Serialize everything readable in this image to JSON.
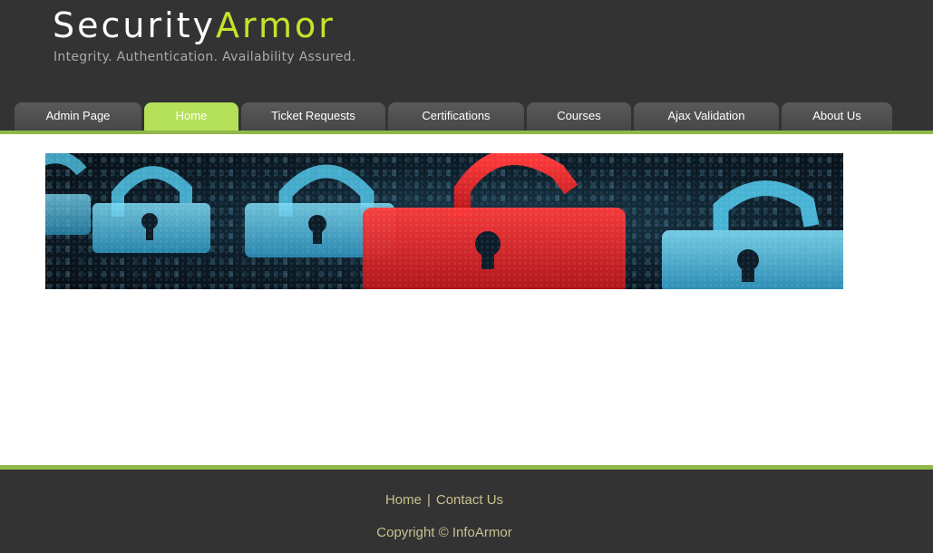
{
  "brand": {
    "name_part1": "Security",
    "name_part2": "Armor",
    "tagline": "Integrity. Authentication. Availability Assured.",
    "colors": {
      "accent": "#c8e22a",
      "header_bg": "#333333",
      "tab_active": "#b5e05a",
      "divider": "#8fb84a"
    }
  },
  "nav": {
    "tabs": [
      {
        "label": "Admin Page",
        "active": false
      },
      {
        "label": "Home",
        "active": true
      },
      {
        "label": "Ticket Requests",
        "active": false
      },
      {
        "label": "Certifications",
        "active": false
      },
      {
        "label": "Courses",
        "active": false
      },
      {
        "label": "Ajax Validation",
        "active": false
      },
      {
        "label": "About Us",
        "active": false
      }
    ]
  },
  "banner": {
    "icon": "padlock-icon",
    "colors": {
      "lock_blue": "#4fc3e6",
      "lock_red": "#e8262c"
    }
  },
  "footer": {
    "links": [
      {
        "label": "Home"
      },
      {
        "label": "Contact Us"
      }
    ],
    "separator": "|",
    "copyright": "Copyright © InfoArmor"
  }
}
